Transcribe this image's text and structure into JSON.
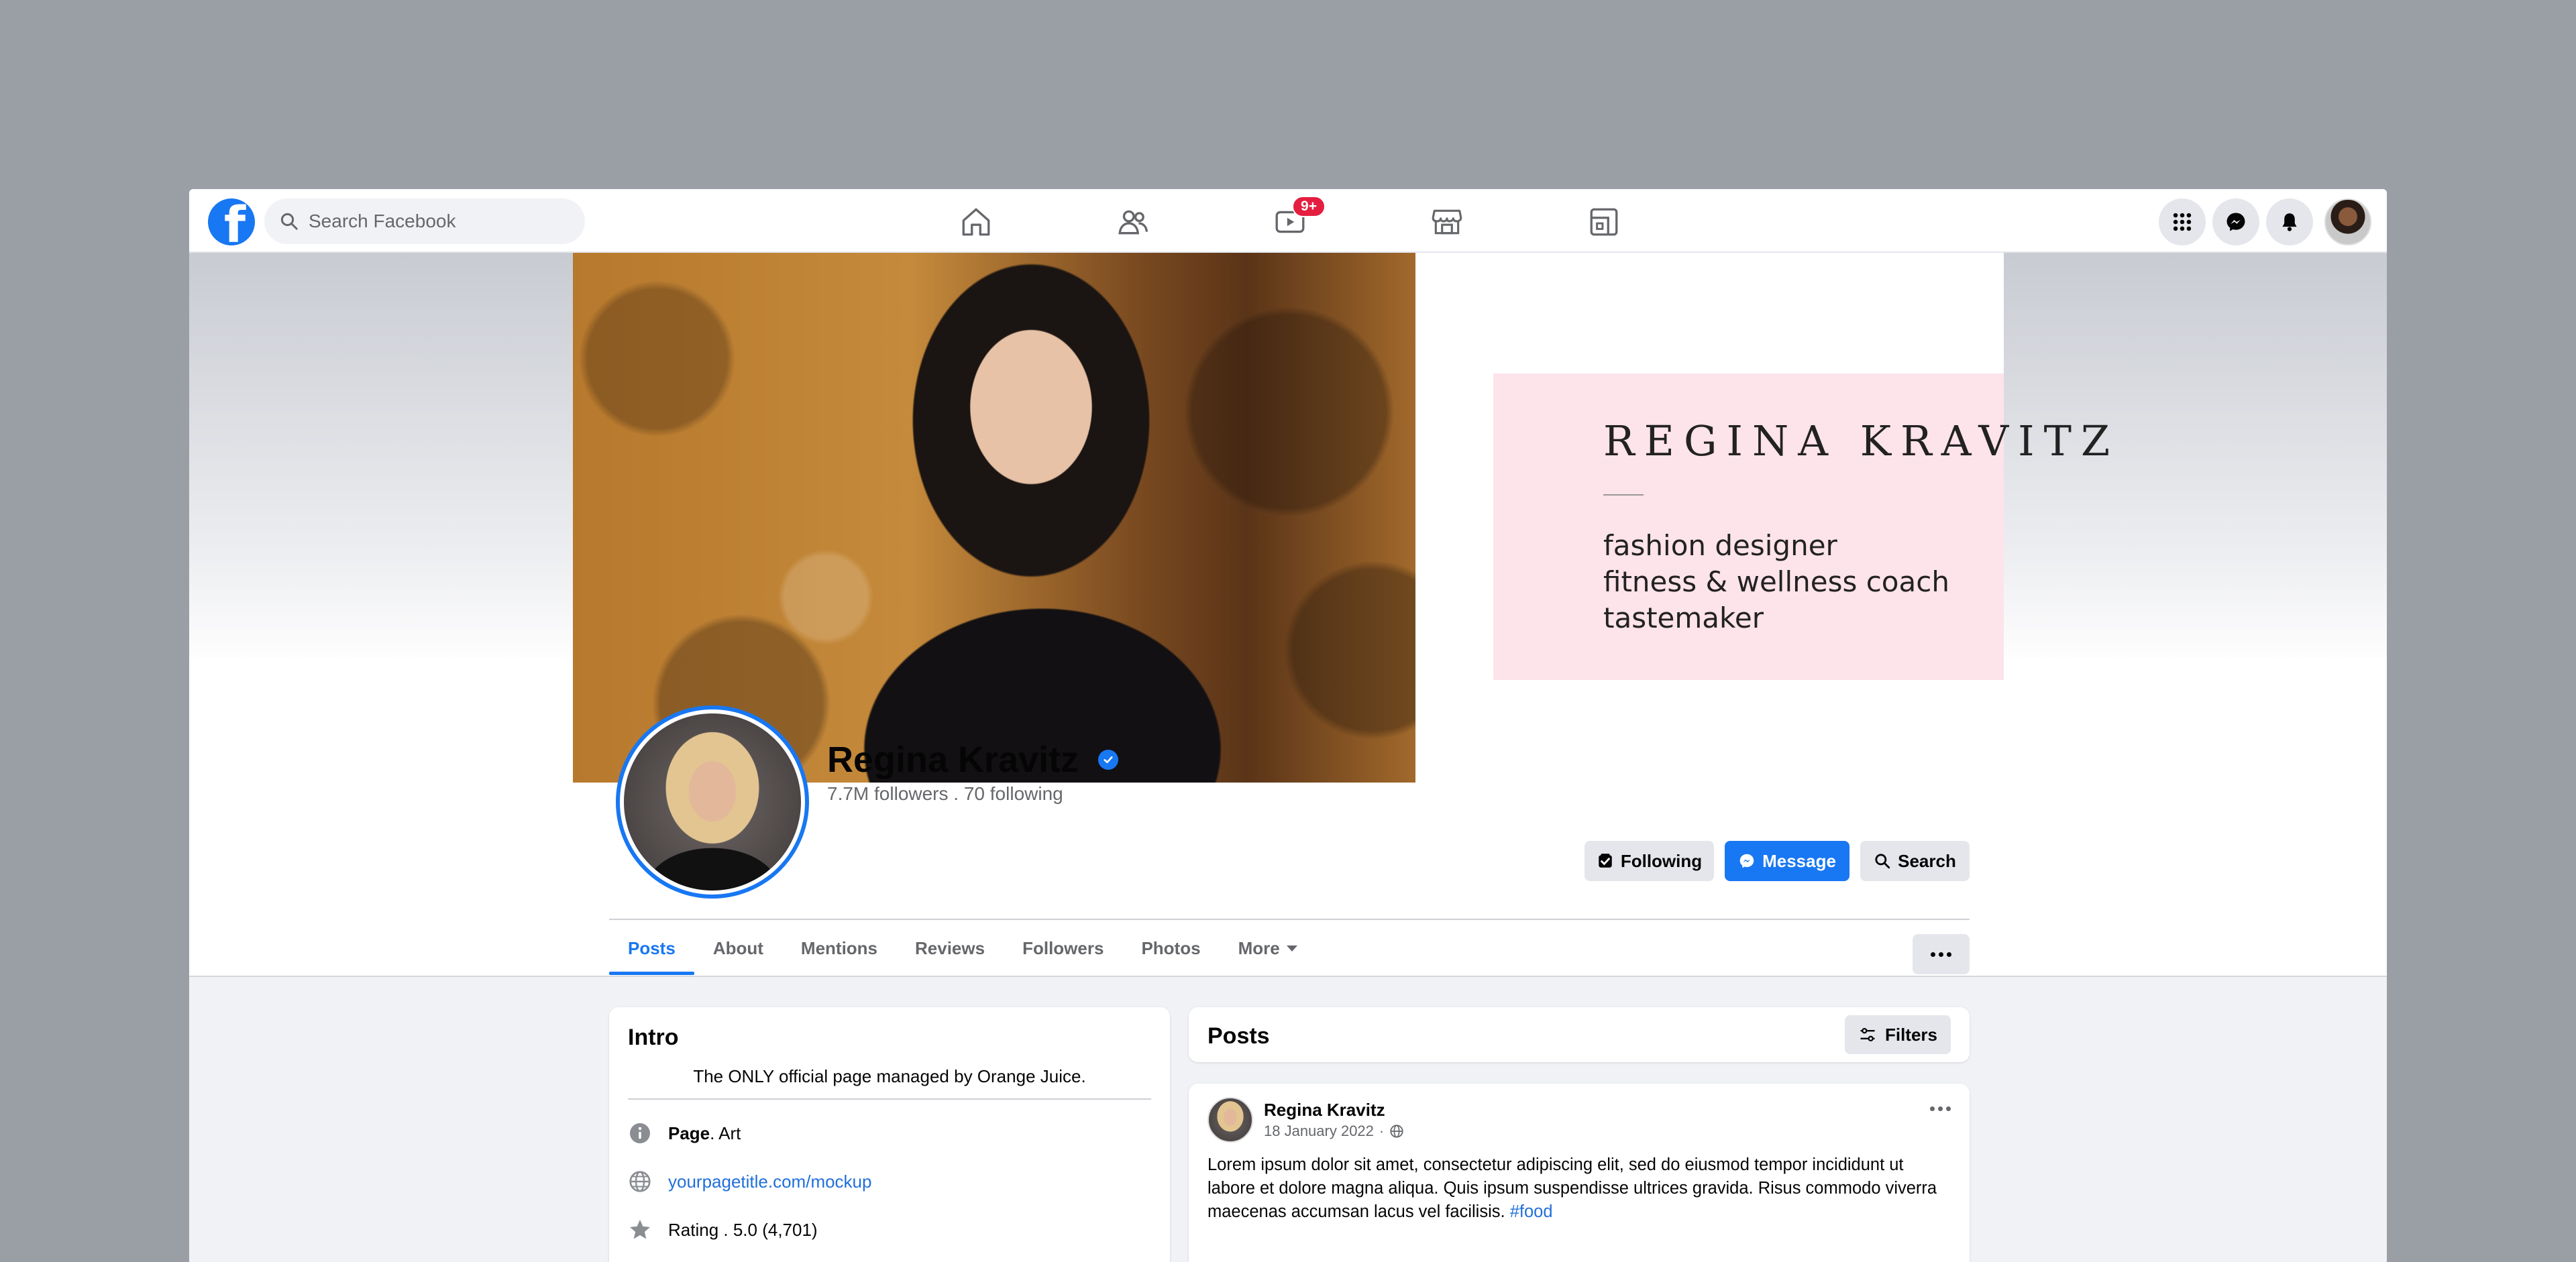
{
  "topbar": {
    "logo_letter": "f",
    "search_placeholder": "Search Facebook",
    "nav_icons": [
      "home-icon",
      "friends-icon",
      "watch-icon",
      "marketplace-icon",
      "gaming-icon"
    ],
    "watch_badge": "9+",
    "right_icons": [
      "menu-grid-icon",
      "messenger-icon",
      "notifications-bell-icon"
    ]
  },
  "cover": {
    "card_name": "REGINA   KRAVITZ",
    "card_lines": [
      "fashion designer",
      "fitness & wellness coach",
      "tastemaker"
    ]
  },
  "profile": {
    "name": "Regina Kravitz",
    "stats": "7.7M followers . 70 following",
    "buttons": {
      "following": "Following",
      "message": "Message",
      "search": "Search"
    }
  },
  "tabs": [
    "Posts",
    "About",
    "Mentions",
    "Reviews",
    "Followers",
    "Photos",
    "More"
  ],
  "intro": {
    "title": "Intro",
    "bio": "The ONLY official page managed by Orange Juice.",
    "page_label": "Page",
    "page_category": " . Art",
    "website": "yourpagetitle.com/mockup",
    "rating": "Rating . 5.0 (4,701)"
  },
  "posts": {
    "title": "Posts",
    "filters_label": "Filters",
    "items": [
      {
        "author": "Regina Kravitz",
        "date": "18 January 2022",
        "text": "Lorem ipsum dolor sit amet, consectetur adipiscing elit, sed do eiusmod tempor incididunt ut labore et dolore magna aliqua. Quis ipsum suspendisse ultrices gravida. Risus commodo viverra maecenas accumsan lacus vel facilisis.",
        "hashtag": "#food"
      }
    ]
  },
  "colors": {
    "brand_blue": "#1877f2",
    "badge_red": "#e41e3f",
    "cover_card_pink": "#fde3ea",
    "page_background": "#9a9ea5"
  }
}
